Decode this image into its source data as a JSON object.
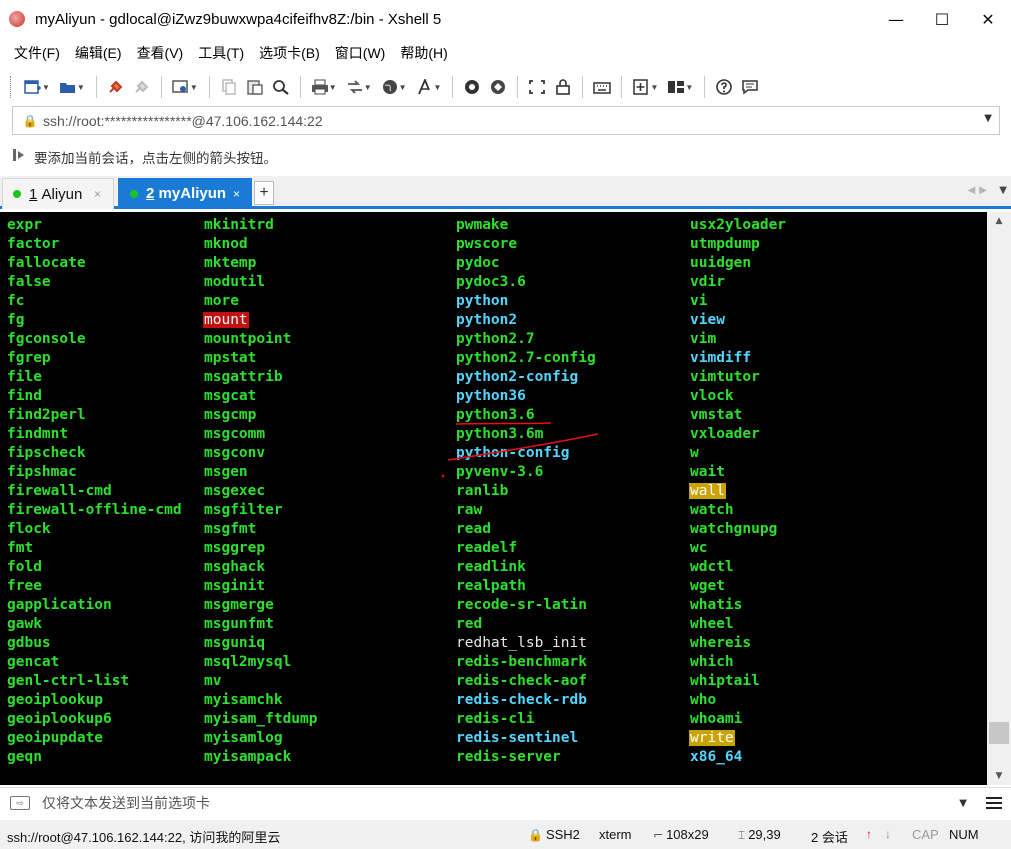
{
  "window": {
    "title": "myAliyun - gdlocal@iZwz9buwxwpa4cifeifhv8Z:/bin - Xshell 5",
    "minimize_glyph": "—",
    "maximize_glyph": "☐",
    "close_glyph": "✕"
  },
  "menu": [
    "文件(F)",
    "编辑(E)",
    "查看(V)",
    "工具(T)",
    "选项卡(B)",
    "窗口(W)",
    "帮助(H)"
  ],
  "address": {
    "value": "ssh://root:****************@47.106.162.144:22"
  },
  "hint": {
    "text": "要添加当前会话，点击左侧的箭头按钮。"
  },
  "tabs": [
    {
      "number": "1",
      "label": "Aliyun",
      "close": "×"
    },
    {
      "number": "2",
      "label": "myAliyun",
      "close": "×"
    }
  ],
  "tab_add": "+",
  "terminal": {
    "columns": [
      [
        {
          "text": "expr",
          "style": "green"
        },
        {
          "text": "factor",
          "style": "green"
        },
        {
          "text": "fallocate",
          "style": "green"
        },
        {
          "text": "false",
          "style": "green"
        },
        {
          "text": "fc",
          "style": "green"
        },
        {
          "text": "fg",
          "style": "green"
        },
        {
          "text": "fgconsole",
          "style": "green"
        },
        {
          "text": "fgrep",
          "style": "green"
        },
        {
          "text": "file",
          "style": "green"
        },
        {
          "text": "find",
          "style": "green"
        },
        {
          "text": "find2perl",
          "style": "green"
        },
        {
          "text": "findmnt",
          "style": "green"
        },
        {
          "text": "fipscheck",
          "style": "green"
        },
        {
          "text": "fipshmac",
          "style": "green"
        },
        {
          "text": "firewall-cmd",
          "style": "green"
        },
        {
          "text": "firewall-offline-cmd",
          "style": "green"
        },
        {
          "text": "flock",
          "style": "green"
        },
        {
          "text": "fmt",
          "style": "green"
        },
        {
          "text": "fold",
          "style": "green"
        },
        {
          "text": "free",
          "style": "green"
        },
        {
          "text": "gapplication",
          "style": "green"
        },
        {
          "text": "gawk",
          "style": "green"
        },
        {
          "text": "gdbus",
          "style": "green"
        },
        {
          "text": "gencat",
          "style": "green"
        },
        {
          "text": "genl-ctrl-list",
          "style": "green"
        },
        {
          "text": "geoiplookup",
          "style": "green"
        },
        {
          "text": "geoiplookup6",
          "style": "green"
        },
        {
          "text": "geoipupdate",
          "style": "green"
        },
        {
          "text": "geqn",
          "style": "green"
        }
      ],
      [
        {
          "text": "mkinitrd",
          "style": "green"
        },
        {
          "text": "mknod",
          "style": "green"
        },
        {
          "text": "mktemp",
          "style": "green"
        },
        {
          "text": "modutil",
          "style": "green"
        },
        {
          "text": "more",
          "style": "green"
        },
        {
          "text": "mount",
          "style": "red-bg"
        },
        {
          "text": "mountpoint",
          "style": "green"
        },
        {
          "text": "mpstat",
          "style": "green"
        },
        {
          "text": "msgattrib",
          "style": "green"
        },
        {
          "text": "msgcat",
          "style": "green"
        },
        {
          "text": "msgcmp",
          "style": "green"
        },
        {
          "text": "msgcomm",
          "style": "green"
        },
        {
          "text": "msgconv",
          "style": "green"
        },
        {
          "text": "msgen",
          "style": "green"
        },
        {
          "text": "msgexec",
          "style": "green"
        },
        {
          "text": "msgfilter",
          "style": "green"
        },
        {
          "text": "msgfmt",
          "style": "green"
        },
        {
          "text": "msggrep",
          "style": "green"
        },
        {
          "text": "msghack",
          "style": "green"
        },
        {
          "text": "msginit",
          "style": "green"
        },
        {
          "text": "msgmerge",
          "style": "green"
        },
        {
          "text": "msgunfmt",
          "style": "green"
        },
        {
          "text": "msguniq",
          "style": "green"
        },
        {
          "text": "msql2mysql",
          "style": "green"
        },
        {
          "text": "mv",
          "style": "green"
        },
        {
          "text": "myisamchk",
          "style": "green"
        },
        {
          "text": "myisam_ftdump",
          "style": "green"
        },
        {
          "text": "myisamlog",
          "style": "green"
        },
        {
          "text": "myisampack",
          "style": "green"
        }
      ],
      [
        {
          "text": "pwmake",
          "style": "green"
        },
        {
          "text": "pwscore",
          "style": "green"
        },
        {
          "text": "pydoc",
          "style": "green"
        },
        {
          "text": "pydoc3.6",
          "style": "green"
        },
        {
          "text": "python",
          "style": "cyan"
        },
        {
          "text": "python2",
          "style": "cyan"
        },
        {
          "text": "python2.7",
          "style": "green"
        },
        {
          "text": "python2.7-config",
          "style": "green"
        },
        {
          "text": "python2-config",
          "style": "cyan"
        },
        {
          "text": "python36",
          "style": "cyan"
        },
        {
          "text": "python3.6",
          "style": "green"
        },
        {
          "text": "python3.6m",
          "style": "green"
        },
        {
          "text": "python-config",
          "style": "cyan"
        },
        {
          "text": "pyvenv-3.6",
          "style": "green"
        },
        {
          "text": "ranlib",
          "style": "green"
        },
        {
          "text": "raw",
          "style": "green"
        },
        {
          "text": "read",
          "style": "green"
        },
        {
          "text": "readelf",
          "style": "green"
        },
        {
          "text": "readlink",
          "style": "green"
        },
        {
          "text": "realpath",
          "style": "green"
        },
        {
          "text": "recode-sr-latin",
          "style": "green"
        },
        {
          "text": "red",
          "style": "green"
        },
        {
          "text": "redhat_lsb_init",
          "style": "white"
        },
        {
          "text": "redis-benchmark",
          "style": "green"
        },
        {
          "text": "redis-check-aof",
          "style": "green"
        },
        {
          "text": "redis-check-rdb",
          "style": "cyan"
        },
        {
          "text": "redis-cli",
          "style": "green"
        },
        {
          "text": "redis-sentinel",
          "style": "cyan"
        },
        {
          "text": "redis-server",
          "style": "green"
        }
      ],
      [
        {
          "text": "usx2yloader",
          "style": "green"
        },
        {
          "text": "utmpdump",
          "style": "green"
        },
        {
          "text": "uuidgen",
          "style": "green"
        },
        {
          "text": "vdir",
          "style": "green"
        },
        {
          "text": "vi",
          "style": "green"
        },
        {
          "text": "view",
          "style": "cyan"
        },
        {
          "text": "vim",
          "style": "green"
        },
        {
          "text": "vimdiff",
          "style": "cyan"
        },
        {
          "text": "vimtutor",
          "style": "green"
        },
        {
          "text": "vlock",
          "style": "green"
        },
        {
          "text": "vmstat",
          "style": "green"
        },
        {
          "text": "vxloader",
          "style": "green"
        },
        {
          "text": "w",
          "style": "green"
        },
        {
          "text": "wait",
          "style": "green"
        },
        {
          "text": "wall",
          "style": "yellow-bg"
        },
        {
          "text": "watch",
          "style": "green"
        },
        {
          "text": "watchgnupg",
          "style": "green"
        },
        {
          "text": "wc",
          "style": "green"
        },
        {
          "text": "wdctl",
          "style": "green"
        },
        {
          "text": "wget",
          "style": "green"
        },
        {
          "text": "whatis",
          "style": "green"
        },
        {
          "text": "wheel",
          "style": "green"
        },
        {
          "text": "whereis",
          "style": "green"
        },
        {
          "text": "which",
          "style": "green"
        },
        {
          "text": "whiptail",
          "style": "green"
        },
        {
          "text": "who",
          "style": "green"
        },
        {
          "text": "whoami",
          "style": "green"
        },
        {
          "text": "write",
          "style": "yellow-bg"
        },
        {
          "text": "x86_64",
          "style": "cyan"
        }
      ]
    ]
  },
  "send_bar": {
    "text": "仅将文本发送到当前选项卡"
  },
  "status": {
    "host": "ssh://root@47.106.162.144:22, 访问我的阿里云",
    "protocol": "SSH2",
    "term_type": "xterm",
    "size": "108x29",
    "cursor": "29,39",
    "sessions": "2 会话",
    "up_arrow": "↑",
    "down_arrow": "↓",
    "cap": "CAP",
    "num": "NUM"
  },
  "colors": {
    "tab_active": "#1a7bd6",
    "terminal_bg": "#000000",
    "term_green": "#2ee02e",
    "term_cyan": "#52d6ff",
    "highlight_red": "#c41010",
    "highlight_yellow": "#c9a400",
    "annotation_red": "#e81010"
  },
  "icons": {
    "toolbar": [
      "new-session-icon",
      "open-folder-icon",
      "connect-icon",
      "disconnect-icon",
      "properties-icon",
      "copy-icon",
      "paste-icon",
      "find-icon",
      "print-icon",
      "transfer-icon",
      "globe-icon",
      "font-icon",
      "xftp-icon",
      "xmanager-icon",
      "fullscreen-icon",
      "lock-icon",
      "keyboard-icon",
      "add-icon",
      "layout-icon",
      "help-icon",
      "chat-icon"
    ]
  }
}
